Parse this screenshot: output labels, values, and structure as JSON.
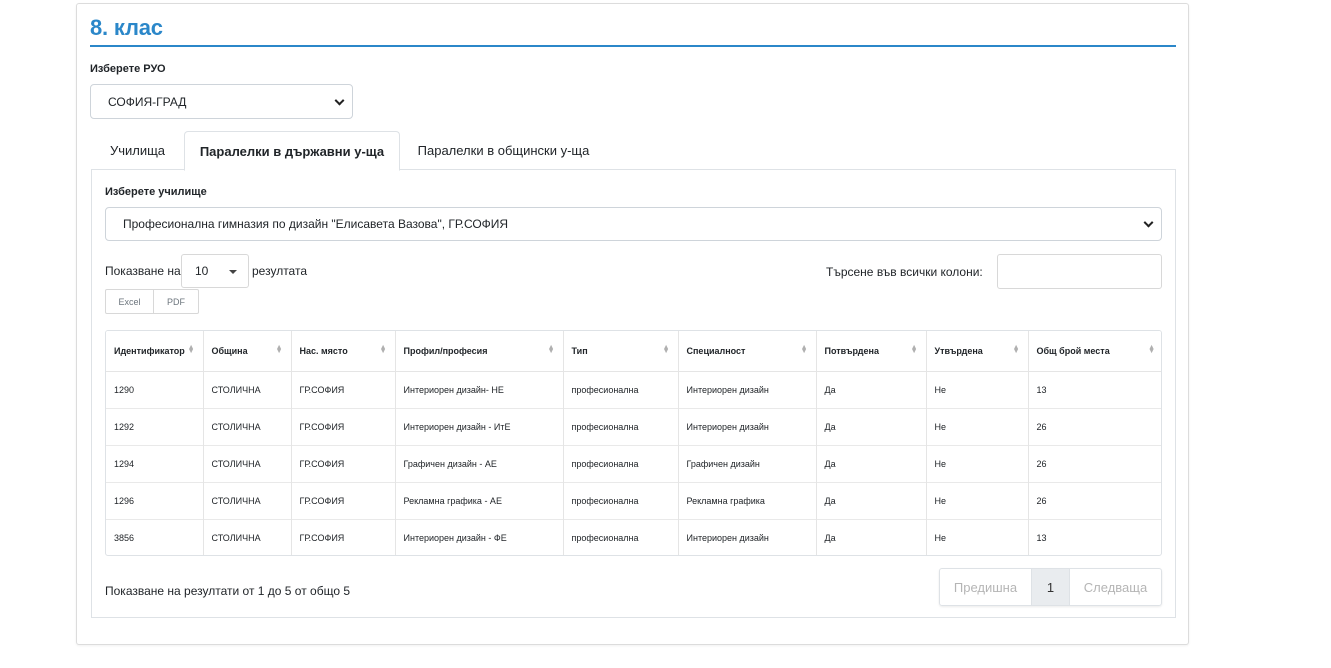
{
  "page": {
    "title": "8. клас"
  },
  "ruo": {
    "label": "Изберете РУО",
    "selected": "СОФИЯ-ГРАД"
  },
  "tabs": [
    {
      "label": "Училища",
      "active": false
    },
    {
      "label": "Паралелки в държавни у-ща",
      "active": true
    },
    {
      "label": "Паралелки в общински у-ща",
      "active": false
    }
  ],
  "school": {
    "label": "Изберете училище",
    "selected": "Професионална гимназия по дизайн \"Елисавета Вазова\", ГР.СОФИЯ"
  },
  "table_controls": {
    "show_prefix": "Показване на",
    "page_length": "10",
    "show_suffix": "резултата",
    "search_label": "Търсене във всички колони:",
    "search_value": "",
    "excel_label": "Excel",
    "pdf_label": "PDF"
  },
  "table": {
    "columns": [
      "Идентификатор",
      "Община",
      "Нас. място",
      "Профил/професия",
      "Тип",
      "Специалност",
      "Потвърдена",
      "Утвърдена",
      "Общ брой места"
    ],
    "rows": [
      [
        "1290",
        "СТОЛИЧНА",
        "ГР.СОФИЯ",
        "Интериорен дизайн- НЕ",
        "професионална",
        "Интериорен дизайн",
        "Да",
        "Не",
        "13"
      ],
      [
        "1292",
        "СТОЛИЧНА",
        "ГР.СОФИЯ",
        "Интериорен дизайн - ИтЕ",
        "професионална",
        "Интериорен дизайн",
        "Да",
        "Не",
        "26"
      ],
      [
        "1294",
        "СТОЛИЧНА",
        "ГР.СОФИЯ",
        "Графичен дизайн - АЕ",
        "професионална",
        "Графичен дизайн",
        "Да",
        "Не",
        "26"
      ],
      [
        "1296",
        "СТОЛИЧНА",
        "ГР.СОФИЯ",
        "Рекламна графика - АЕ",
        "професионална",
        "Рекламна графика",
        "Да",
        "Не",
        "26"
      ],
      [
        "3856",
        "СТОЛИЧНА",
        "ГР.СОФИЯ",
        "Интериорен дизайн - ФЕ",
        "професионална",
        "Интериорен дизайн",
        "Да",
        "Не",
        "13"
      ]
    ]
  },
  "footer": {
    "info": "Показване на резултати от 1 до 5 от общо 5",
    "prev_label": "Предишна",
    "current_page": "1",
    "next_label": "Следваща"
  },
  "colors": {
    "accent": "#2b87c9"
  }
}
